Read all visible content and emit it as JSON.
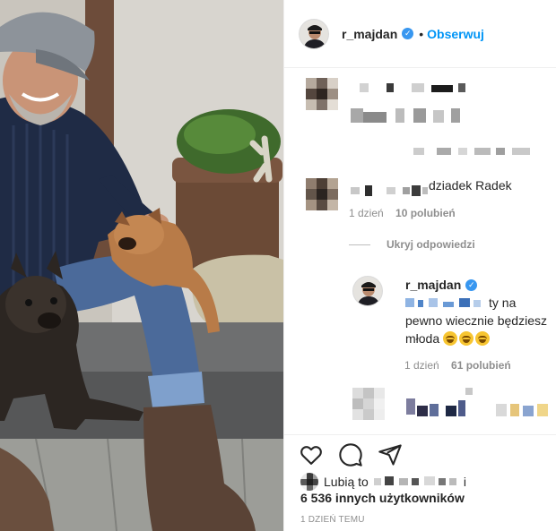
{
  "post": {
    "photo_alt": "Mężczyzna w czapce z psami na schodach"
  },
  "header": {
    "username": "r_majdan",
    "verified_mark": "✓",
    "separator": "•",
    "follow_label": "Obserwuj"
  },
  "comments": [
    {
      "text_suffix": "dziadek Radek",
      "time": "1 dzień",
      "likes": "10 polubień"
    }
  ],
  "hide_replies_label": "Ukryj odpowiedzi",
  "reply": {
    "username": "r_majdan",
    "verified_mark": "✓",
    "text_part1": "ty na",
    "text_part2": "pewno wiecznie będziesz młoda",
    "time": "1 dzień",
    "likes": "61 polubień"
  },
  "footer": {
    "liked_by_prefix": "Lubią to",
    "liked_by_suffix": "i",
    "others": "6 536 innych użytkowników",
    "timestamp": "1 DZIEŃ TEMU"
  },
  "icons": {
    "like": "heart-icon",
    "comment": "comment-icon",
    "share": "share-icon"
  },
  "colors": {
    "link_blue": "#0095f6",
    "verified_blue": "#3897f0",
    "meta_gray": "#8e8e8e",
    "text": "#262626"
  }
}
